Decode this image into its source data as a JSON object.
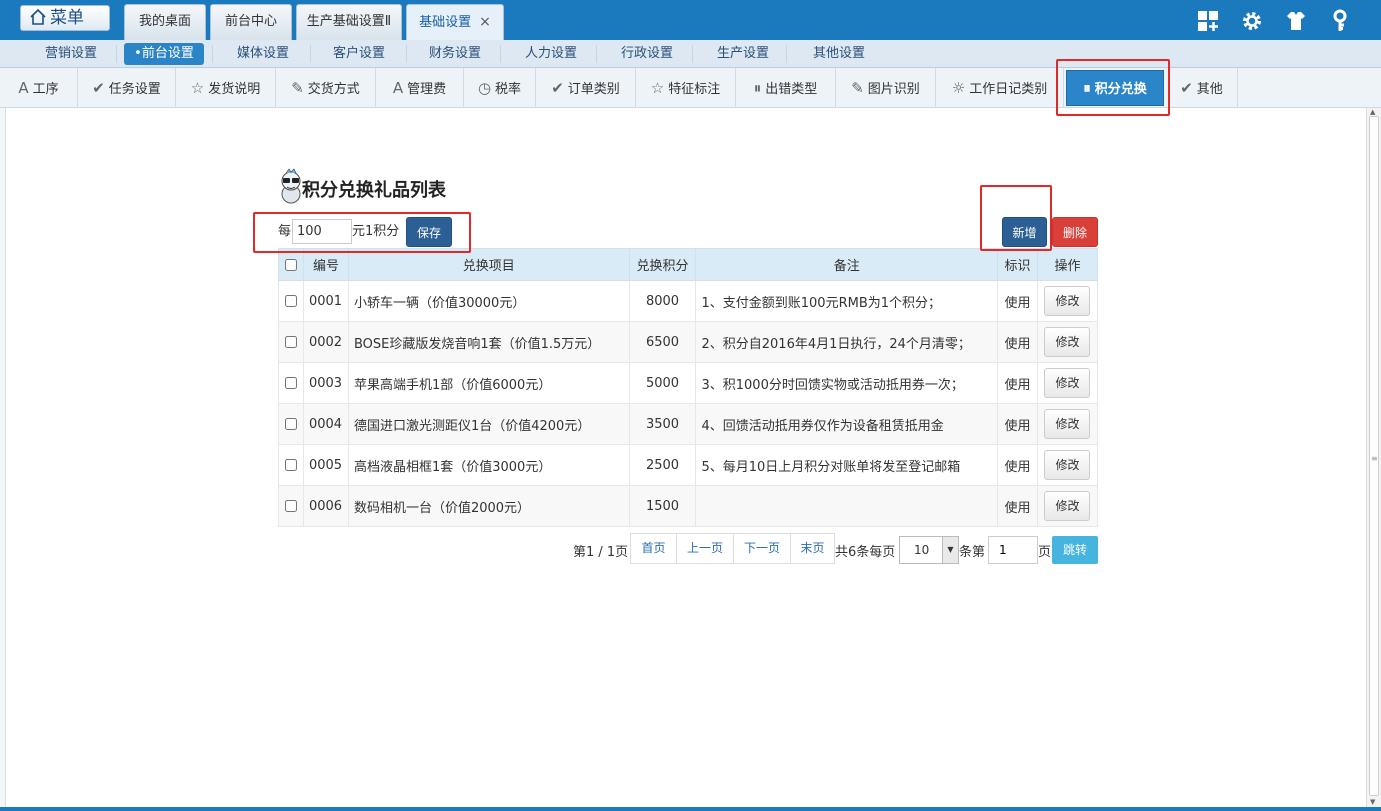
{
  "header": {
    "menu_label": "菜单",
    "tabs": [
      {
        "label": "我的桌面"
      },
      {
        "label": "前台中心"
      },
      {
        "label": "生产基础设置Ⅱ"
      },
      {
        "label": "基础设置",
        "close": "×"
      }
    ],
    "icons": [
      "grid-icon",
      "gear-icon",
      "shirt-icon",
      "key-icon"
    ]
  },
  "subnav": {
    "items": [
      "营销设置",
      "•前台设置",
      "媒体设置",
      "客户设置",
      "财务设置",
      "人力设置",
      "行政设置",
      "生产设置",
      "其他设置"
    ],
    "active": "•前台设置"
  },
  "toolbar": {
    "items": [
      {
        "label": "工序",
        "icon": "A"
      },
      {
        "label": "任务设置",
        "icon": "✔"
      },
      {
        "label": "发货说明",
        "icon": "☆"
      },
      {
        "label": "交货方式",
        "icon": "✎"
      },
      {
        "label": "管理费",
        "icon": "A"
      },
      {
        "label": "税率",
        "icon": "◷"
      },
      {
        "label": "订单类别",
        "icon": "✔"
      },
      {
        "label": "特征标注",
        "icon": "☆"
      },
      {
        "label": "出错类型",
        "icon": "⏸"
      },
      {
        "label": "图片识别",
        "icon": "✎"
      },
      {
        "label": "工作日记类别",
        "icon": "☼"
      },
      {
        "label": "积分兑换",
        "icon": "⏸"
      },
      {
        "label": "其他",
        "icon": "✔"
      }
    ],
    "active": "积分兑换"
  },
  "main": {
    "title": "积分兑换礼品列表",
    "rate_prefix": "每",
    "rate_value": "100",
    "rate_suffix": "元1积分",
    "save_label": "保存",
    "add_label": "新增",
    "delete_label": "删除"
  },
  "table": {
    "columns": [
      "编号",
      "兑换项目",
      "兑换积分",
      "备注",
      "标识",
      "操作"
    ],
    "rows": [
      {
        "id": "0001",
        "item": "小轿车一辆（价值30000元）",
        "points": "8000",
        "note": "1、支付金额到账100元RMB为1个积分；",
        "flag": "使用",
        "action": "修改"
      },
      {
        "id": "0002",
        "item": "BOSE珍藏版发烧音响1套（价值1.5万元）",
        "points": "6500",
        "note": "2、积分自2016年4月1日执行，24个月清零；",
        "flag": "使用",
        "action": "修改"
      },
      {
        "id": "0003",
        "item": "苹果高端手机1部（价值6000元）",
        "points": "5000",
        "note": "3、积1000分时回馈实物或活动抵用券一次；",
        "flag": "使用",
        "action": "修改"
      },
      {
        "id": "0004",
        "item": "德国进口激光测距仪1台（价值4200元）",
        "points": "3500",
        "note": "4、回馈活动抵用券仅作为设备租赁抵用金",
        "flag": "使用",
        "action": "修改"
      },
      {
        "id": "0005",
        "item": "高档液晶相框1套（价值3000元）",
        "points": "2500",
        "note": "5、每月10日上月积分对账单将发至登记邮箱",
        "flag": "使用",
        "action": "修改"
      },
      {
        "id": "0006",
        "item": "数码相机一台（价值2000元）",
        "points": "1500",
        "note": "",
        "flag": "使用",
        "action": "修改"
      }
    ]
  },
  "pager": {
    "page_info": "第1 / 1页",
    "first": "首页",
    "prev": "上一页",
    "next": "下一页",
    "last": "末页",
    "total_info": "共6条每页",
    "page_size": "10",
    "unit": "条第",
    "page_value": "1",
    "page_suffix": "页",
    "jump": "跳转"
  },
  "colors": {
    "brand_blue": "#1b79be",
    "highlight_red": "#e02a2a",
    "delete_red": "#d9403a",
    "jump_cyan": "#45b5e0"
  }
}
